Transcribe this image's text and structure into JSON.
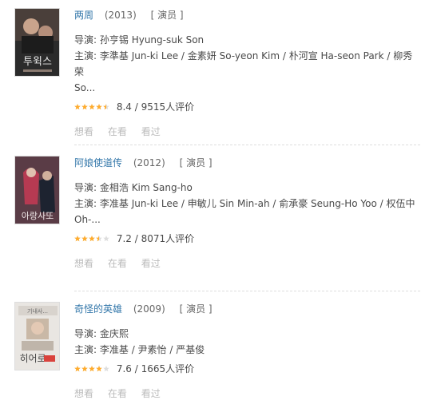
{
  "works": [
    {
      "title": "两周",
      "year": "(2013)",
      "role": "[ 演员 ]",
      "director_label": "导演:",
      "director": "孙亨锡 Hyung-suk Son",
      "cast_label": "主演:",
      "cast_line1": "李準基 Jun-ki Lee / 金素妍 So-yeon Kim / 朴河宣 Ha-seon Park / 柳秀荣",
      "cast_line2": "So...",
      "rating_text": "8.4 / 9515人评价",
      "stars": 4.5,
      "actions": [
        "想看",
        "在看",
        "看过"
      ]
    },
    {
      "title": "阿娘使道传",
      "year": "(2012)",
      "role": "[ 演员 ]",
      "director_label": "导演:",
      "director": "金相浩 Kim Sang-ho",
      "cast_label": "主演:",
      "cast_line1": "李准基 Jun-ki Lee / 申敏儿 Sin Min-ah / 俞承豪 Seung-Ho Yoo / 权伍中",
      "cast_line2": "Oh-...",
      "rating_text": "7.2 / 8071人评价",
      "stars": 3.5,
      "actions": [
        "想看",
        "在看",
        "看过"
      ]
    },
    {
      "title": "奇怪的英雄",
      "year": "(2009)",
      "role": "[ 演员 ]",
      "director_label": "导演:",
      "director": "金庆熙",
      "cast_label": "主演:",
      "cast_line1": "李准基 / 尹素怡 / 严基俊",
      "cast_line2": "",
      "rating_text": "7.6 / 1665人评价",
      "stars": 4,
      "actions": [
        "想看",
        "在看",
        "看过"
      ]
    }
  ],
  "colors": {
    "link": "#3377aa",
    "star": "#ffac2d",
    "star_empty": "#dddddd",
    "action": "#bbbbbb"
  }
}
